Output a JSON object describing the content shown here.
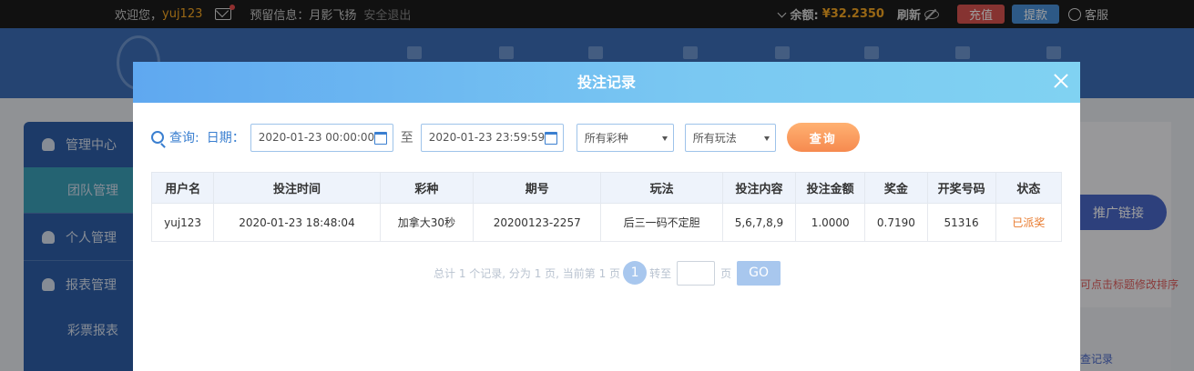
{
  "topbar": {
    "welcome": "欢迎您，",
    "username": "yuj123",
    "reserve_info": "预留信息：月影飞扬",
    "logout": "安全退出",
    "balance_label": "余额:",
    "balance_value": "¥32.2350",
    "refresh": "刷新",
    "recharge": "充值",
    "withdraw": "提款",
    "service": "客服"
  },
  "sidebar": {
    "items": [
      {
        "label": "管理中心"
      },
      {
        "label": "团队管理"
      },
      {
        "label": "个人管理"
      },
      {
        "label": "报表管理"
      },
      {
        "label": "彩票报表"
      }
    ]
  },
  "background": {
    "promo_link": "推广链接",
    "hint": "可点击标题修改排序",
    "record": "查记录"
  },
  "modal": {
    "title": "投注记录",
    "filter": {
      "query_label": "查询:",
      "date_label": "日期：",
      "start_date": "2020-01-23 00:00:00",
      "to_label": "至",
      "end_date": "2020-01-23 23:59:59",
      "lottery_select": "所有彩种",
      "play_select": "所有玩法",
      "query_button": "查询"
    },
    "table": {
      "headers": [
        "用户名",
        "投注时间",
        "彩种",
        "期号",
        "玩法",
        "投注内容",
        "投注金额",
        "奖金",
        "开奖号码",
        "状态"
      ],
      "rows": [
        [
          "yuj123",
          "2020-01-23 18:48:04",
          "加拿大30秒",
          "20200123-2257",
          "后三一码不定胆",
          "5,6,7,8,9",
          "1.0000",
          "0.7190",
          "51316",
          "已派奖"
        ]
      ]
    },
    "pager": {
      "summary": "总计 1 个记录, 分为 1 页, 当前第 1 页",
      "current_page": "1",
      "goto_label": "转至",
      "page_unit": "页",
      "go_button": "GO"
    }
  },
  "colors": {
    "accent_blue": "#3a7fd0",
    "status_orange": "#e8782a",
    "query_orange": "#f68a4f"
  }
}
